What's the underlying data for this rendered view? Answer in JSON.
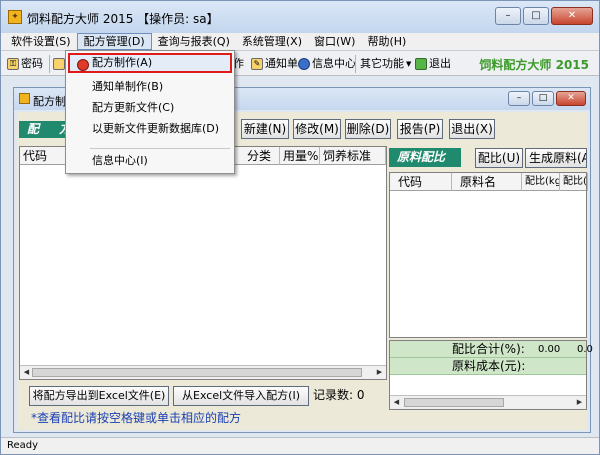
{
  "window": {
    "title": "饲料配方大师 2015 【操作员: sa】",
    "caption_min": "–",
    "caption_max": "□",
    "caption_close": "✕"
  },
  "menubar": {
    "items": [
      {
        "label": "软件设置(S)"
      },
      {
        "label": "配方管理(D)"
      },
      {
        "label": "查询与报表(Q)"
      },
      {
        "label": "系统管理(X)"
      },
      {
        "label": "窗口(W)"
      },
      {
        "label": "帮助(H)"
      }
    ]
  },
  "toolbar": {
    "password": "密码",
    "make_partial": "作",
    "notice": "通知单",
    "info_center": "信息中心",
    "other_functions": "其它功能",
    "exit": "退出",
    "brand": "饲料配方大师  2015"
  },
  "dropdown": {
    "items": [
      {
        "label": "配方制作(A)"
      },
      {
        "label": "通知单制作(B)"
      },
      {
        "label": "配方更新文件(C)"
      },
      {
        "label": "以更新文件更新数据库(D)"
      },
      {
        "label": "信息中心(I)"
      }
    ]
  },
  "child": {
    "title": "配方制作",
    "green_tag": "配 方",
    "buttons": {
      "new": "新建(N)",
      "edit": "修改(M)",
      "delete": "删除(D)",
      "report": "报告(P)",
      "exit": "退出(X)"
    },
    "left_grid": {
      "columns": [
        "代码",
        "分类",
        "用量%",
        "饲养标准"
      ]
    },
    "right_tag": "原料配比",
    "right_buttons": {
      "ratio": "配比(U)",
      "generate": "生成原料(A"
    },
    "right_grid": {
      "columns": [
        "代码",
        "原料名",
        "配比(kg)",
        "配比(%"
      ]
    },
    "summary": {
      "total_label": "配比合计(%):",
      "total_v1": "0.00",
      "total_v2": "0.0",
      "cost_label": "原料成本(元):"
    },
    "export_button": "将配方导出到Excel文件(E)",
    "import_button": "从Excel文件导入配方(I)",
    "records_label": "记录数: 0",
    "hint": "*查看配比请按空格键或单击相应的配方"
  },
  "status": {
    "text": "Ready"
  },
  "colors": {
    "accent_green": "#1f8a6e",
    "brand_green": "#3c9a2a",
    "highlight_red": "#e0191b"
  }
}
